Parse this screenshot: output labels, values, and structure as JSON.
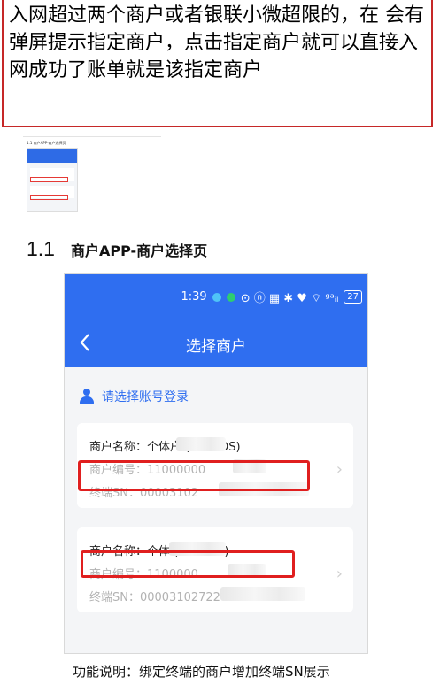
{
  "note": {
    "text": "入网超过两个商户或者银联小微超限的，在 会有弹屏提示指定商户，点击指定商户就可以直接入网成功了账单就是该指定商户"
  },
  "thumbnail": {
    "title": "1.1 商户APP-商户选择页"
  },
  "section": {
    "number": "1.1",
    "title": "商户APP-商户选择页"
  },
  "phone": {
    "status_bar": {
      "time": "1:39",
      "signal": "⊙ ⓝ ▦ ✱ ♥ ⌔ ᵍᵃᵢₗ",
      "battery": "27"
    },
    "nav": {
      "back_icon": "chevron-left-icon",
      "title": "选择商户"
    },
    "login_prompt": "请选择账号登录",
    "merchants": [
      {
        "name": "商户名称：个体户  (电签POS)",
        "code": "商户编号：11000000",
        "sn": "终端SN：00003102"
      },
      {
        "name": "商户名称：个体  (电签POS)",
        "code": "商户编号：1100000",
        "sn": "终端SN：00003102722"
      }
    ]
  },
  "caption": "功能说明：绑定终端的商户增加终端SN展示",
  "colors": {
    "primary": "#2f6ef0",
    "highlight": "#e01f1f",
    "note_border": "#c62828"
  }
}
